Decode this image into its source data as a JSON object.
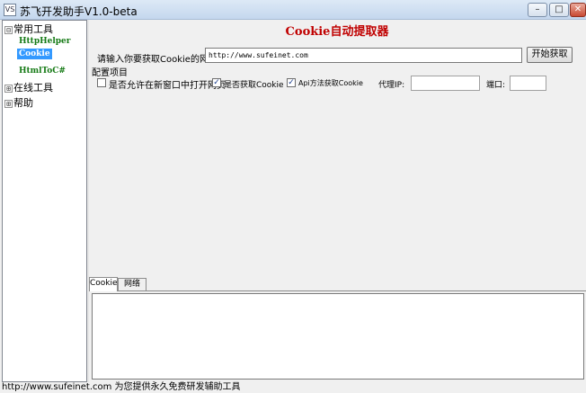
{
  "window": {
    "title": "苏飞开发助手V1.0-beta",
    "app_icon_text": "VS",
    "minimize_glyph": "–",
    "maximize_glyph": "□",
    "close_glyph": "✕"
  },
  "tree": {
    "nodes": [
      {
        "toggle": "⊟",
        "label": "常用工具"
      },
      {
        "toggle": "⊞",
        "label": "在线工具"
      },
      {
        "toggle": "⊞",
        "label": "帮助"
      }
    ],
    "children": [
      {
        "label": "HttpHelper",
        "selected": false
      },
      {
        "label": "Cookie",
        "selected": true
      },
      {
        "label": "HtmlToC#",
        "selected": false
      }
    ]
  },
  "main": {
    "title": "Cookie自动提取器",
    "url_label": "请输入你要获取Cookie的网址:",
    "url_value": "http://www.sufeinet.com",
    "fetch_button": "开始获取",
    "config_group": "配置项目",
    "options": [
      {
        "label": "是否允许在新窗口中打开网页",
        "checked": false
      },
      {
        "label": "是否获取Cookie",
        "checked": true
      },
      {
        "label": "Api方法获取Cookie",
        "checked": true
      }
    ],
    "proxy_label": "代理IP:",
    "proxy_value": "",
    "port_label": "端口:",
    "port_value": "",
    "check_glyph": "✓"
  },
  "tabs": [
    {
      "label": "Cookie",
      "active": true
    },
    {
      "label": "网络",
      "active": false
    }
  ],
  "status_bar": {
    "text": "http://www.sufeinet.com 为您提供永久免费研发辅助工具"
  }
}
